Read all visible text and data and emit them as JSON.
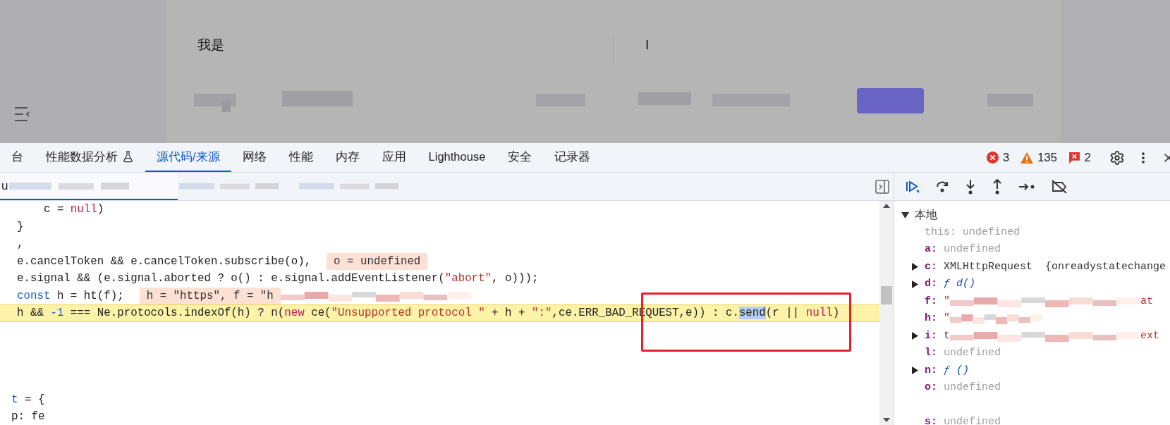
{
  "page_behind": {
    "cells": [
      "我是",
      "I"
    ]
  },
  "devtools": {
    "tabs": [
      {
        "label": "台",
        "selected": false,
        "kind": "plain"
      },
      {
        "label": "性能数据分析",
        "selected": false,
        "kind": "experiment"
      },
      {
        "label": "源代码/来源",
        "selected": true,
        "kind": "plain"
      },
      {
        "label": "网络",
        "selected": false,
        "kind": "plain"
      },
      {
        "label": "性能",
        "selected": false,
        "kind": "plain"
      },
      {
        "label": "内存",
        "selected": false,
        "kind": "plain"
      },
      {
        "label": "应用",
        "selected": false,
        "kind": "plain"
      },
      {
        "label": "Lighthouse",
        "selected": false,
        "kind": "plain"
      },
      {
        "label": "安全",
        "selected": false,
        "kind": "plain"
      },
      {
        "label": "记录器",
        "selected": false,
        "kind": "plain"
      }
    ],
    "counters": [
      {
        "kind": "error",
        "count": "3"
      },
      {
        "kind": "warning",
        "count": "135"
      },
      {
        "kind": "issue",
        "count": "2"
      }
    ],
    "file_tabs": [
      {
        "label": "u",
        "selected": true
      },
      {
        "selected": false
      },
      {
        "selected": false
      }
    ],
    "code_lines": [
      {
        "kind": "code",
        "paused": false,
        "tokens": [
          {
            "kind": "plain",
            "text": "    c = "
          },
          {
            "kind": "keyword",
            "text": "null"
          },
          {
            "kind": "plain",
            "text": ")"
          }
        ]
      },
      {
        "kind": "code",
        "paused": false,
        "tokens": [
          {
            "kind": "plain",
            "text": "}"
          }
        ]
      },
      {
        "kind": "code",
        "paused": false,
        "tokens": [
          {
            "kind": "plain",
            "text": ","
          }
        ]
      },
      {
        "kind": "code",
        "paused": false,
        "tokens": [
          {
            "kind": "plain",
            "text": "e.cancelToken && e.cancelToken.subscribe(o),"
          },
          {
            "kind": "inline_value",
            "text": "o = undefined"
          }
        ]
      },
      {
        "kind": "code",
        "paused": false,
        "tokens": [
          {
            "kind": "plain",
            "text": "e.signal && (e.signal.aborted ? o() : e.signal.addEventListener("
          },
          {
            "kind": "string",
            "text": "\"abort\""
          },
          {
            "kind": "plain",
            "text": ", o)));"
          }
        ]
      },
      {
        "kind": "code",
        "paused": false,
        "tokens": [
          {
            "kind": "declaration",
            "text": "const"
          },
          {
            "kind": "plain",
            "text": " h = ht(f);"
          },
          {
            "kind": "inline_value",
            "text": "h = \"https\", f = \"h"
          },
          {
            "kind": "redacted_long"
          }
        ]
      },
      {
        "kind": "code",
        "paused": true,
        "tokens": [
          {
            "kind": "plain",
            "text": "h && "
          },
          {
            "kind": "number",
            "text": "-1"
          },
          {
            "kind": "plain",
            "text": " === Ne.protocols.indexOf(h) ? n("
          },
          {
            "kind": "keyword",
            "text": "new"
          },
          {
            "kind": "plain",
            "text": " ce("
          },
          {
            "kind": "string",
            "text": "\"Unsupported protocol \""
          },
          {
            "kind": "plain",
            "text": " + h + "
          },
          {
            "kind": "string",
            "text": "\":\""
          },
          {
            "kind": "plain",
            "text": ",ce.ERR_BAD_REQUEST,e)) : c."
          },
          {
            "kind": "selection",
            "text": "send"
          },
          {
            "kind": "plain",
            "text": "(r || "
          },
          {
            "kind": "keyword",
            "text": "null"
          },
          {
            "kind": "plain",
            "text": ")"
          }
        ]
      },
      {
        "kind": "blank"
      },
      {
        "kind": "blank"
      },
      {
        "kind": "blank"
      },
      {
        "kind": "blank"
      },
      {
        "kind": "outdented",
        "paused": false,
        "tokens": [
          {
            "kind": "declaration",
            "text": "t"
          },
          {
            "kind": "plain",
            "text": " = {"
          }
        ]
      },
      {
        "kind": "outdented",
        "paused": false,
        "tokens": [
          {
            "kind": "plain",
            "text": "p: fe"
          }
        ]
      }
    ],
    "scope": {
      "title": "本地",
      "expanded": true,
      "vars": [
        {
          "name": "this:",
          "dimmed": true,
          "expandable": false,
          "value": [
            {
              "kind": "undefined",
              "text": "undefined"
            }
          ]
        },
        {
          "name": "a:",
          "dimmed": false,
          "expandable": false,
          "value": [
            {
              "kind": "undefined",
              "text": "undefined"
            }
          ]
        },
        {
          "name": "c:",
          "dimmed": false,
          "expandable": true,
          "value": [
            {
              "kind": "object",
              "text": "XMLHttpRequest  {onreadystatechange"
            }
          ]
        },
        {
          "name": "d:",
          "dimmed": false,
          "expandable": true,
          "value": [
            {
              "kind": "function",
              "text": "ƒ d()"
            }
          ]
        },
        {
          "name": "f:",
          "dimmed": false,
          "expandable": false,
          "value": [
            {
              "kind": "string",
              "text": "\""
            },
            {
              "kind": "redacted_long"
            },
            {
              "kind": "string",
              "text": "at"
            }
          ]
        },
        {
          "name": "h:",
          "dimmed": false,
          "expandable": false,
          "value": [
            {
              "kind": "string",
              "text": "\""
            },
            {
              "kind": "redacted_short"
            }
          ]
        },
        {
          "name": "i:",
          "dimmed": false,
          "expandable": true,
          "value": [
            {
              "kind": "object",
              "text": "t"
            },
            {
              "kind": "redacted_long"
            },
            {
              "kind": "string",
              "text": "ext"
            }
          ]
        },
        {
          "name": "l:",
          "dimmed": false,
          "expandable": false,
          "value": [
            {
              "kind": "undefined",
              "text": "undefined"
            }
          ]
        },
        {
          "name": "n:",
          "dimmed": false,
          "expandable": true,
          "value": [
            {
              "kind": "function",
              "text": "ƒ ()"
            }
          ]
        },
        {
          "name": "o:",
          "dimmed": false,
          "expandable": false,
          "value": [
            {
              "kind": "undefined",
              "text": "undefined"
            }
          ]
        },
        {
          "kind": "hidden"
        },
        {
          "name": "s:",
          "dimmed": false,
          "expandable": false,
          "value": [
            {
              "kind": "undefined",
              "text": "undefined"
            }
          ]
        }
      ]
    }
  },
  "callout": {
    "kind": "red_box"
  }
}
